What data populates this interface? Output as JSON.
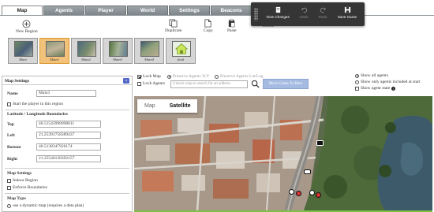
{
  "tabs": [
    {
      "label": "Map",
      "active": true
    },
    {
      "label": "Agents",
      "active": false
    },
    {
      "label": "Player",
      "active": false
    },
    {
      "label": "World",
      "active": false
    },
    {
      "label": "Settings",
      "active": false
    },
    {
      "label": "Beacons",
      "active": false
    }
  ],
  "savebar": {
    "view_changes": "View Changes",
    "undo": "Undo",
    "redo": "Redo",
    "save_game": "Save Game"
  },
  "toolbar": {
    "new_region": "New Region",
    "duplicate": "Duplicate",
    "copy": "Copy",
    "paste": "Paste",
    "delete": "Delete"
  },
  "regions": [
    {
      "label": "Main",
      "selected": false
    },
    {
      "label": "Main1",
      "selected": true
    },
    {
      "label": "Main2",
      "selected": false
    },
    {
      "label": "Main3",
      "selected": false
    },
    {
      "label": "Main4",
      "selected": false
    },
    {
      "label": "final",
      "selected": false
    }
  ],
  "settings_panel": {
    "title": "Map Settings",
    "collapse_glyph": "«",
    "name_label": "Name",
    "name_value": "Main1",
    "start_player_label": "Start the player in this region",
    "latlng_heading": "Latitude / Longitude Boundaries",
    "top_label": "Top",
    "top_value": "40.51543998998811",
    "left_label": "Left",
    "left_value": "21.25391758389437",
    "bottom_label": "Bottom",
    "bottom_value": "40.5138347926174",
    "right_label": "Right",
    "right_value": "21.25540138392157",
    "map_settings_heading": "Map Settings",
    "indoor_region": "Indoor Region",
    "enforce_boundaries": "Enforce Boundaries",
    "map_type_heading": "Map Type",
    "dynamic_map_option": "use a dynamic map (requires a data plan)"
  },
  "map_controls": {
    "lock_map": "Lock Map",
    "lock_map_checked": true,
    "lock_agents": "Lock Agents",
    "lock_agents_checked": false,
    "preserve_xy": "Preserve Agents X/Y",
    "preserve_latlng": "Preserve Agents Lat/Lng",
    "search_placeholder": "Unlock map to search for an address",
    "move_button": "Move Game To Here",
    "show_all": "Show all agents",
    "show_only": "Show only agents included at start",
    "show_state": "Show agent state"
  },
  "map": {
    "tab_map": "Map",
    "tab_satellite": "Satellite",
    "active_tab": "Satellite"
  },
  "colors": {
    "tab_bg": "#8a9297",
    "savebar_bg": "#353535",
    "selected_region": "#f2c27a",
    "move_button": "#a6bbe2",
    "accent_green": "#7dc144"
  }
}
